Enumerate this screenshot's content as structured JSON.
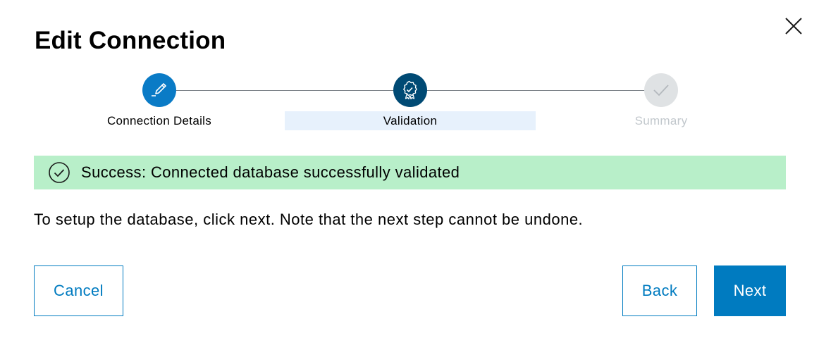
{
  "dialog": {
    "title": "Edit Connection",
    "close_icon": "close-icon"
  },
  "stepper": {
    "steps": [
      {
        "label": "Connection Details",
        "state": "completed",
        "icon": "pencil-icon"
      },
      {
        "label": "Validation",
        "state": "active",
        "icon": "badge-check-icon"
      },
      {
        "label": "Summary",
        "state": "pending",
        "icon": "checkmark-icon"
      }
    ]
  },
  "notification": {
    "type": "success",
    "icon": "check-circle-icon",
    "text": "Success: Connected database successfully validated"
  },
  "body": {
    "info_text": "To setup the database, click next. Note that the next step cannot be undone."
  },
  "actions": {
    "cancel_label": "Cancel",
    "back_label": "Back",
    "next_label": "Next"
  },
  "colors": {
    "primary": "#007bc0",
    "step_active": "#004a74",
    "step_completed": "#0a7bc6",
    "step_pending": "#dfe2e4",
    "success_bg": "#b8efc9",
    "active_step_label_bg": "#e7f1fc"
  }
}
